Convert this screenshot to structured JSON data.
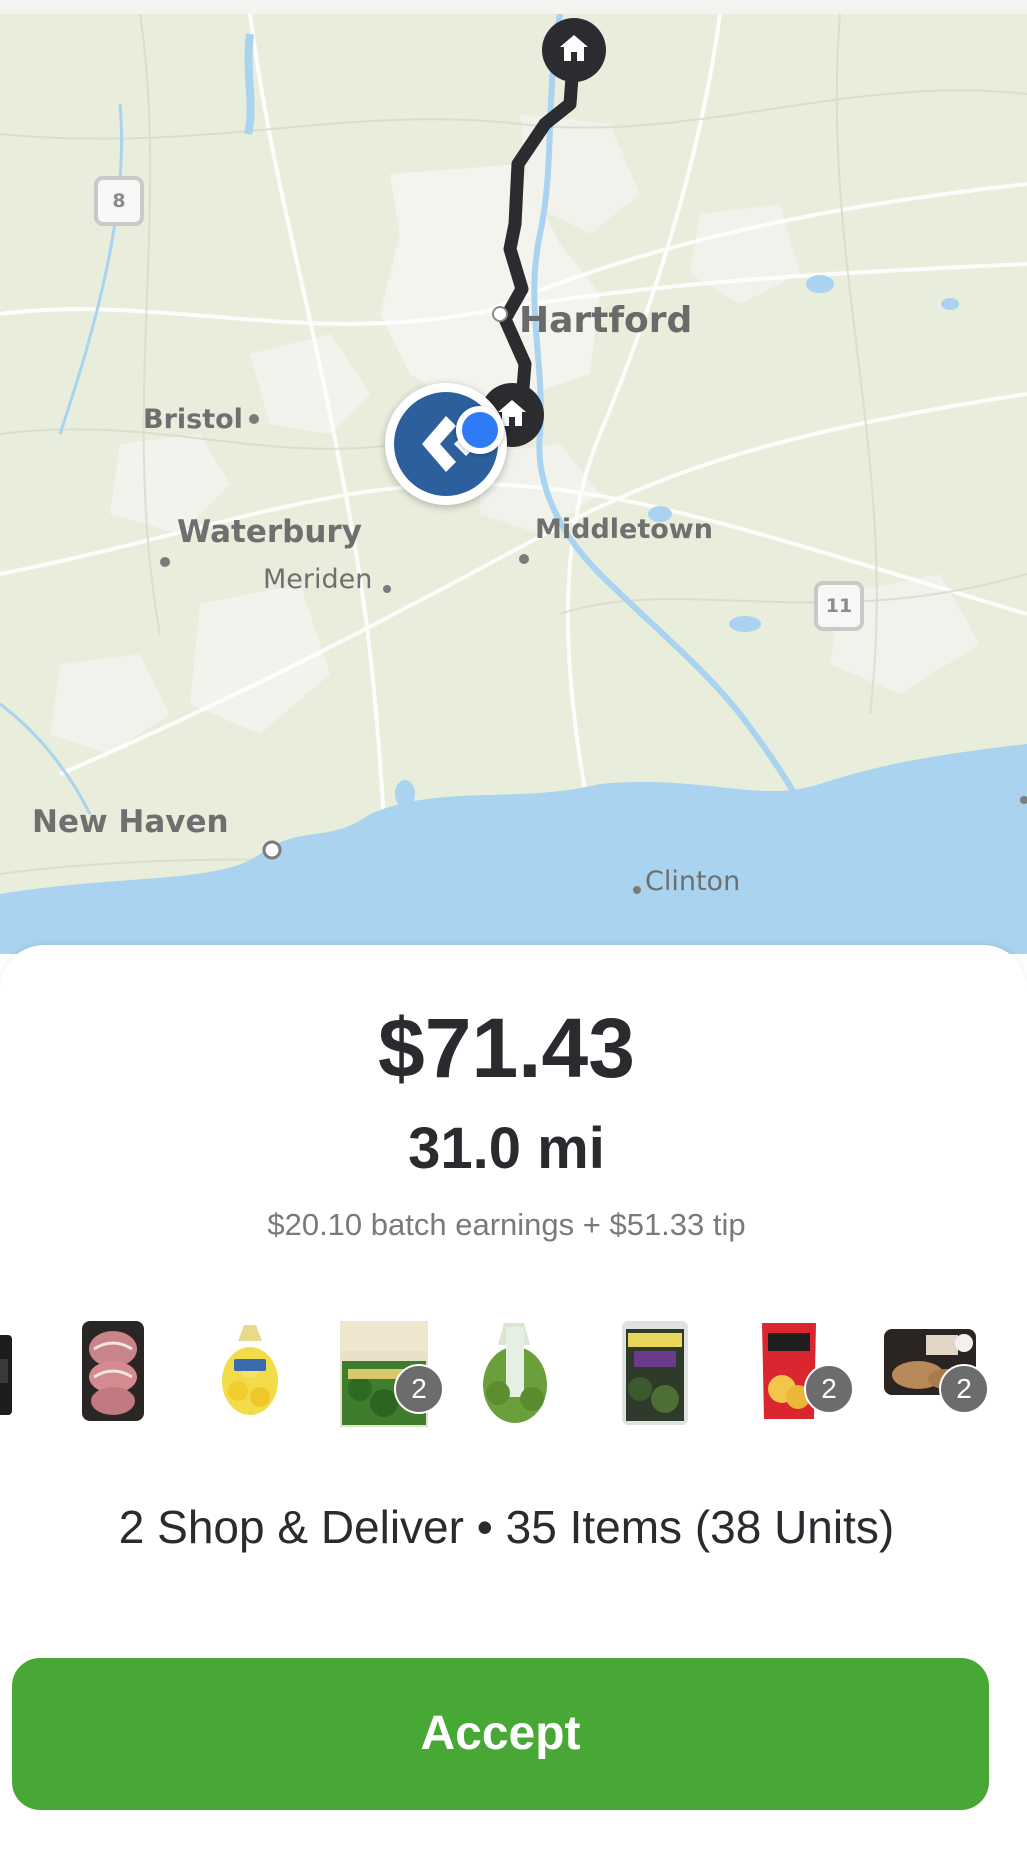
{
  "map": {
    "cities": {
      "hartford": "Hartford",
      "bristol": "Bristol",
      "waterbury": "Waterbury",
      "meriden": "Meriden",
      "middletown": "Middletown",
      "new_haven": "New Haven",
      "clinton": "Clinton"
    },
    "route_shields": {
      "route_8": "8",
      "route_11": "11"
    },
    "icons": [
      "home-icon",
      "home-icon",
      "shopper-app-logo-icon",
      "current-location-icon"
    ]
  },
  "offer": {
    "price": "$71.43",
    "distance": "31.0 mi",
    "breakdown": "$20.10 batch earnings + $51.33 tip",
    "summary": "2 Shop & Deliver • 35 Items (38 Units)",
    "accept_label": "Accept"
  },
  "items": [
    {
      "name": "bottle-item",
      "qty": ""
    },
    {
      "name": "pork-chops-item",
      "qty": ""
    },
    {
      "name": "lemons-bag-item",
      "qty": ""
    },
    {
      "name": "broccoli-florets-item",
      "qty": "2"
    },
    {
      "name": "avocado-bag-item",
      "qty": ""
    },
    {
      "name": "organic-greens-item",
      "qty": ""
    },
    {
      "name": "chips-bag-item",
      "qty": "2"
    },
    {
      "name": "pulled-chicken-item",
      "qty": "2"
    }
  ],
  "colors": {
    "accent_green": "#48a835",
    "route_line": "#2b2c30",
    "driver_badge": "#2c5f9c",
    "location_dot": "#2f7bf6",
    "map_land": "#e9eedd",
    "map_water": "#a9d3ee"
  }
}
